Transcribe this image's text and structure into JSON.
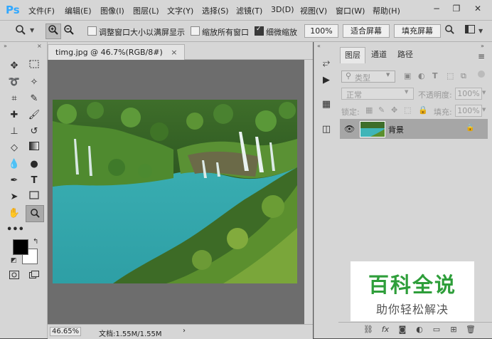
{
  "app": {
    "logo": "Ps"
  },
  "menu": [
    "文件(F)",
    "编辑(E)",
    "图像(I)",
    "图层(L)",
    "文字(Y)",
    "选择(S)",
    "滤镜(T)",
    "3D(D)",
    "视图(V)",
    "窗口(W)",
    "帮助(H)"
  ],
  "window_controls": {
    "minimize": "−",
    "restore": "❐",
    "close": "✕"
  },
  "options": {
    "resize_windows_label": "调整窗口大小以满屏显示",
    "zoom_all_label": "缩放所有窗口",
    "scrubby_zoom_label": "细微缩放",
    "zoom_value": "100%",
    "fit_screen_label": "适合屏幕",
    "fill_screen_label": "填充屏幕",
    "resize_windows_checked": false,
    "zoom_all_checked": false,
    "scrubby_zoom_checked": true
  },
  "document": {
    "tab_title": "timg.jpg @ 46.7%(RGB/8#)",
    "close": "×"
  },
  "status": {
    "zoom": "46.65%",
    "doc_info": "文档:1.55M/1.55M",
    "arrow": "›"
  },
  "layers_panel": {
    "tabs": [
      "图层",
      "通道",
      "路径"
    ],
    "active_tab": 0,
    "filter_label": "类型",
    "blend_mode": "正常",
    "opacity_label": "不透明度:",
    "opacity_value": "100%",
    "lock_label": "锁定:",
    "fill_label": "填充:",
    "fill_value": "100%",
    "layers": [
      {
        "name": "背景",
        "locked": true,
        "visible": true
      }
    ]
  },
  "watermark": {
    "title": "百科全说",
    "subtitle": "助你轻松解决"
  },
  "colors": {
    "foreground": "#000000",
    "background": "#ffffff",
    "accent": "#31a8ff",
    "watermark_green": "#2e9e3a"
  }
}
